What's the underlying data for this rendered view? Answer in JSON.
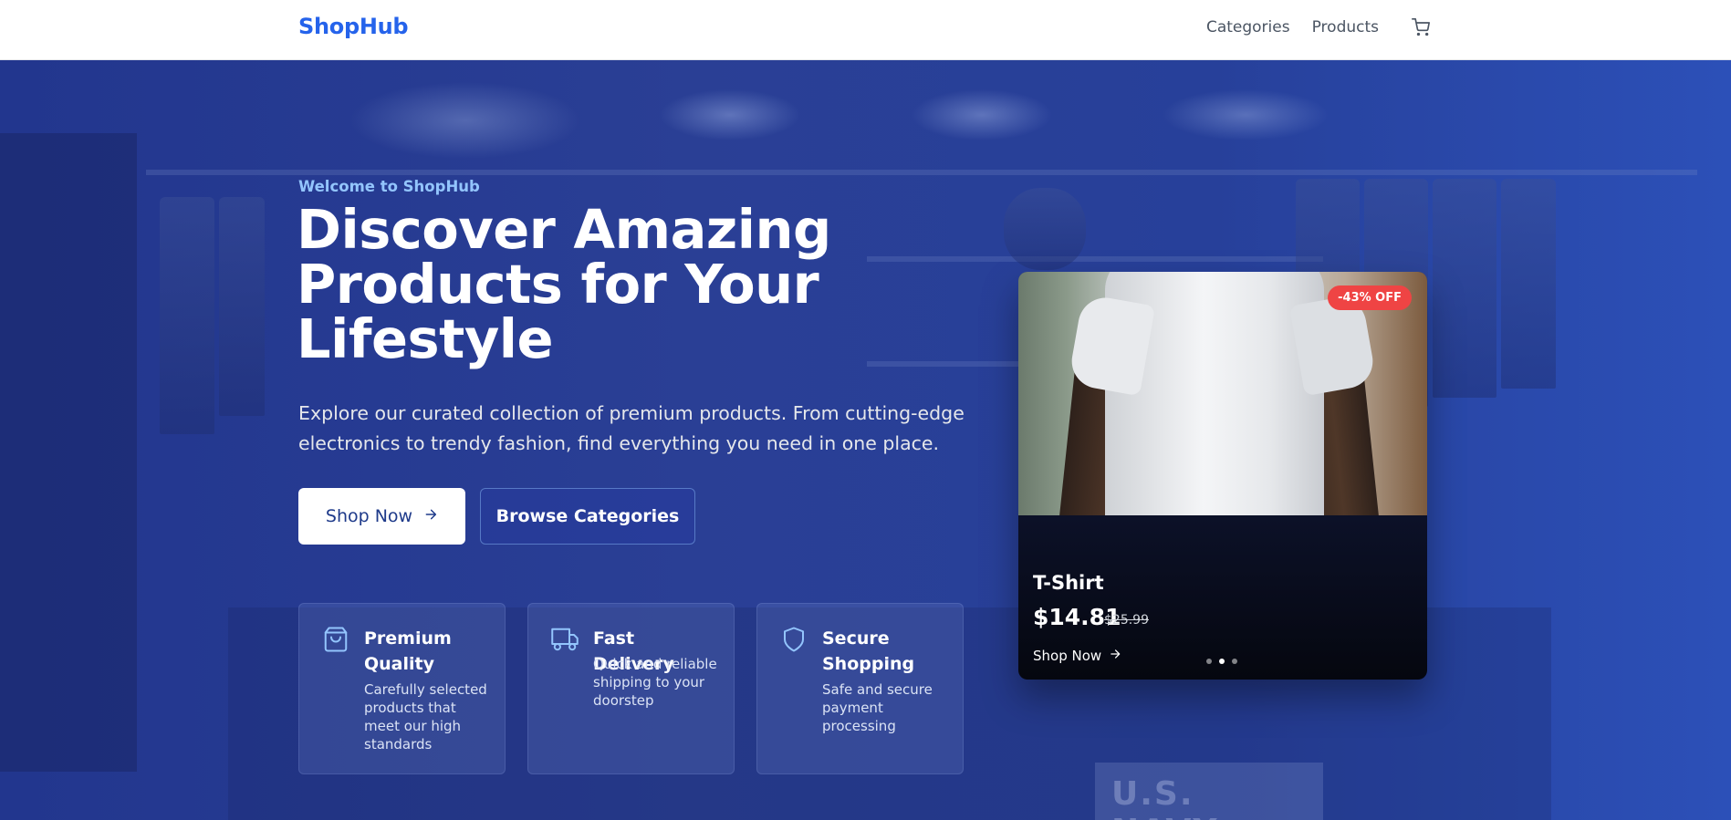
{
  "nav": {
    "logo": "ShopHub",
    "links": [
      "Categories",
      "Products"
    ],
    "cart_icon": "cart-icon"
  },
  "hero": {
    "welcome": "Welcome to ShopHub",
    "headline": "Discover Amazing Products for Your Lifestyle",
    "subtext": "Explore our curated collection of premium products. From cutting-edge electronics to trendy fashion, find everything you need in one place.",
    "primary_button": "Shop Now",
    "secondary_button": "Browse Categories",
    "background_text": "U.S. NAVY"
  },
  "features": [
    {
      "icon": "shopping-bag-icon",
      "title": "Premium Quality",
      "description": "Carefully selected products that meet our high standards"
    },
    {
      "icon": "truck-icon",
      "title": "Fast Delivery",
      "description": "Quick and reliable shipping to your doorstep"
    },
    {
      "icon": "shield-icon",
      "title": "Secure Shopping",
      "description": "Safe and secure payment processing"
    }
  ],
  "featured_product": {
    "badge": "-43% OFF",
    "name": "T-Shirt",
    "price": "$14.81",
    "original_price": "$25.99",
    "link": "Shop Now",
    "carousel_active_index": 1,
    "carousel_count": 3
  },
  "colors": {
    "brand": "#2563eb",
    "hero_bg": "#22368e",
    "discount_badge": "#ef4444",
    "accent_text": "#93c5fd"
  }
}
